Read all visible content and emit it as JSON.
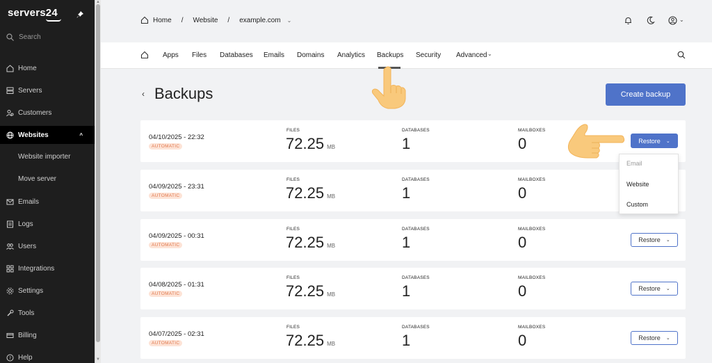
{
  "brand": {
    "name": "servers24"
  },
  "sidebar": {
    "search_label": "Search",
    "items": [
      {
        "label": "Home",
        "icon": "home-icon"
      },
      {
        "label": "Servers",
        "icon": "server-icon"
      },
      {
        "label": "Customers",
        "icon": "customers-icon"
      },
      {
        "label": "Websites",
        "icon": "globe-icon",
        "active": true
      },
      {
        "label": "Emails",
        "icon": "mail-icon"
      },
      {
        "label": "Logs",
        "icon": "logs-icon"
      },
      {
        "label": "Users",
        "icon": "users-icon"
      },
      {
        "label": "Integrations",
        "icon": "integrations-icon"
      },
      {
        "label": "Settings",
        "icon": "gear-icon"
      },
      {
        "label": "Tools",
        "icon": "tools-icon"
      },
      {
        "label": "Billing",
        "icon": "billing-icon"
      },
      {
        "label": "Help",
        "icon": "help-icon"
      }
    ],
    "sub_items": [
      "Website importer",
      "Move server"
    ]
  },
  "breadcrumb": {
    "home": "Home",
    "section": "Website",
    "domain": "example.com"
  },
  "tabs": [
    "Apps",
    "Files",
    "Databases",
    "Emails",
    "Domains",
    "Analytics",
    "Backups",
    "Security",
    "Advanced"
  ],
  "active_tab": "Backups",
  "page": {
    "title": "Backups",
    "create_label": "Create backup"
  },
  "labels": {
    "files": "FILES",
    "databases": "DATABASES",
    "mailboxes": "MAILBOXES",
    "unit": "MB",
    "restore": "Restore"
  },
  "backups": [
    {
      "date": "04/10/2025 - 22:32",
      "type": "AUTOMATIC",
      "files": "72.25",
      "databases": "1",
      "mailboxes": "0"
    },
    {
      "date": "04/09/2025 - 23:31",
      "type": "AUTOMATIC",
      "files": "72.25",
      "databases": "1",
      "mailboxes": "0"
    },
    {
      "date": "04/09/2025 - 00:31",
      "type": "AUTOMATIC",
      "files": "72.25",
      "databases": "1",
      "mailboxes": "0"
    },
    {
      "date": "04/08/2025 - 01:31",
      "type": "AUTOMATIC",
      "files": "72.25",
      "databases": "1",
      "mailboxes": "0"
    },
    {
      "date": "04/07/2025 - 02:31",
      "type": "AUTOMATIC",
      "files": "72.25",
      "databases": "1",
      "mailboxes": "0"
    }
  ],
  "restore_menu": {
    "options": [
      "Email",
      "Website",
      "Custom"
    ],
    "disabled": [
      "Email"
    ]
  },
  "colors": {
    "accent": "#4f73c9",
    "sidebar_bg": "#1e1e1e",
    "badge_text": "#e07a50",
    "badge_bg": "#fde3d6",
    "pointer": "#f9c97c"
  }
}
